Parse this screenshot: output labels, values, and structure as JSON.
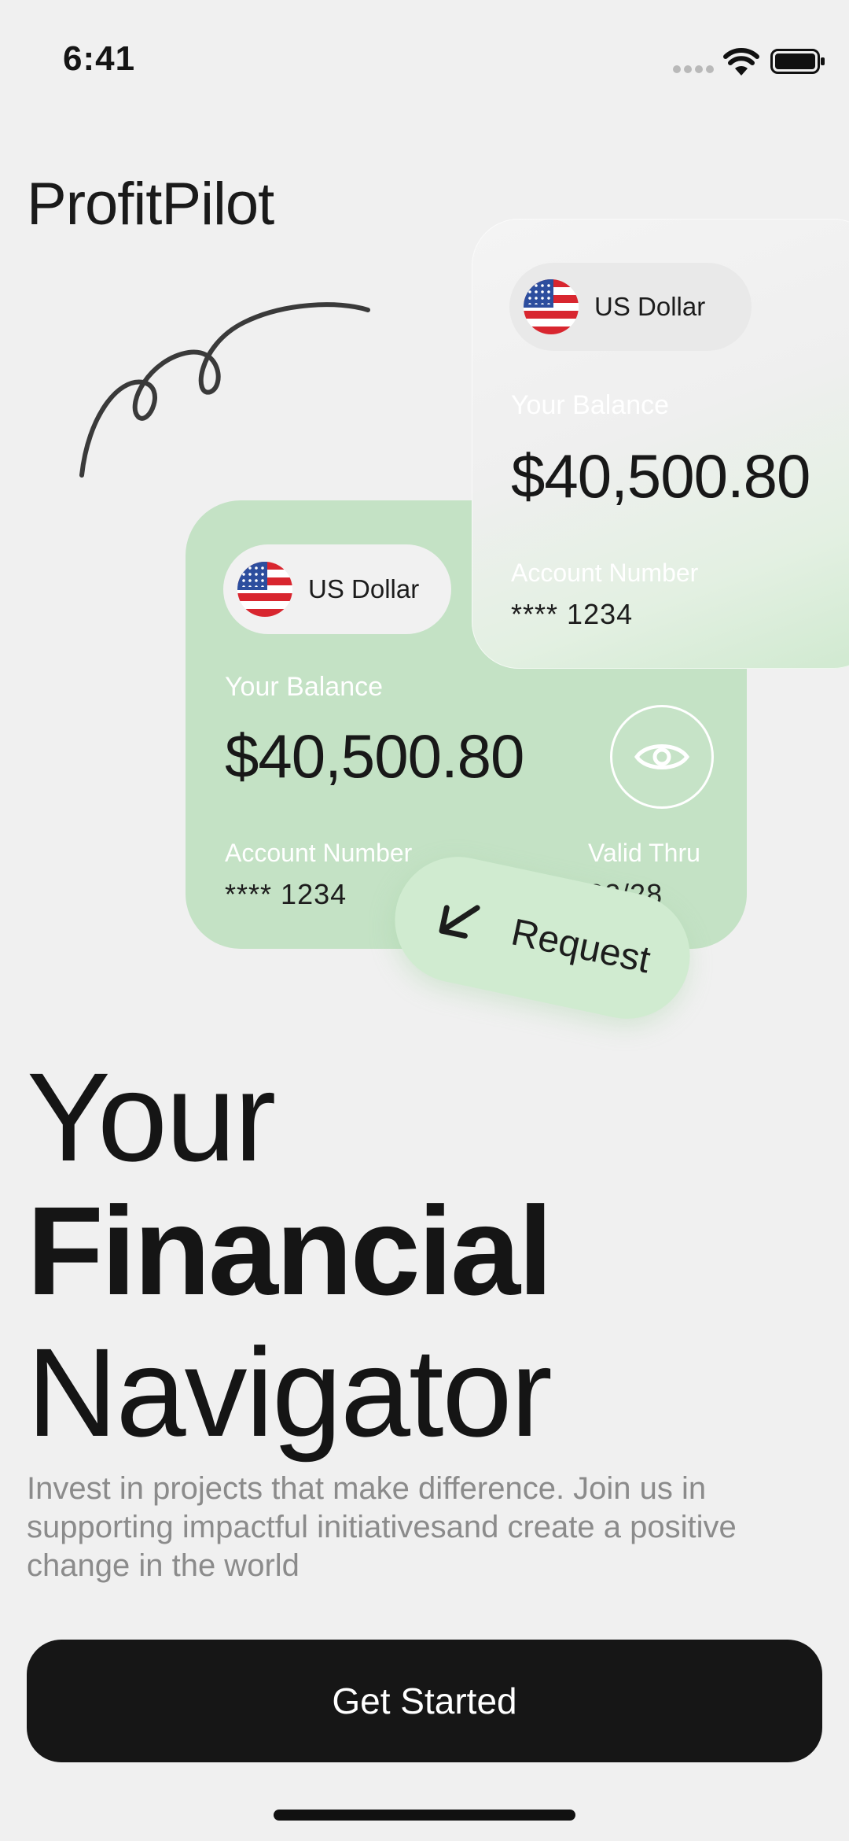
{
  "status_bar": {
    "time": "6:41"
  },
  "brand": "ProfitPilot",
  "card_back": {
    "currency": "US Dollar",
    "balance_label": "Your Balance",
    "balance": "$40,500.80",
    "account_label": "Account Number",
    "account_number": "**** 1234"
  },
  "card_front": {
    "currency": "US Dollar",
    "balance_label": "Your Balance",
    "balance": "$40,500.80",
    "account_label": "Account Number",
    "account_number": "**** 1234",
    "valid_label": "Valid Thru",
    "valid_value": "02/28"
  },
  "request_button": {
    "label": "Request",
    "icon": "arrow-down-left-icon"
  },
  "headline": {
    "line1": "Your",
    "line2": "Financial",
    "line3": "Navigator"
  },
  "description": "Invest in projects that make difference. Join us in supporting impactful initiativesand create a positive change in the world",
  "cta": {
    "label": "Get Started"
  },
  "colors": {
    "card_green": "#c4e2c5",
    "button_dark": "#161616",
    "background": "#f0f0f0"
  }
}
